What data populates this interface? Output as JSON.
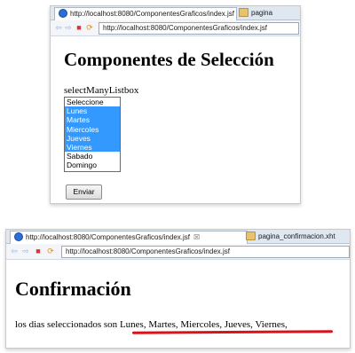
{
  "window1": {
    "tabs": [
      {
        "label": "http://localhost:8080/ComponentesGraficos/index.jsf",
        "close": "☒"
      },
      {
        "label": "pagina"
      }
    ],
    "url": "http://localhost:8080/ComponentesGraficos/index.jsf",
    "heading": "Componentes de Selección",
    "list_label": "selectManyListbox",
    "list_options": [
      {
        "label": "Seleccione",
        "selected": false
      },
      {
        "label": "Lunes",
        "selected": true
      },
      {
        "label": "Martes",
        "selected": true
      },
      {
        "label": "Miercoles",
        "selected": true
      },
      {
        "label": "Jueves",
        "selected": true
      },
      {
        "label": "Viernes",
        "selected": true
      },
      {
        "label": "Sabado",
        "selected": false
      },
      {
        "label": "Domingo",
        "selected": false
      }
    ],
    "submit_label": "Enviar"
  },
  "window2": {
    "tabs": [
      {
        "label": "http://localhost:8080/ComponentesGraficos/index.jsf",
        "close": "☒"
      },
      {
        "label": "pagina_confirmacion.xht"
      }
    ],
    "url": "http://localhost:8080/ComponentesGraficos/index.jsf",
    "heading": "Confirmación",
    "text_prefix": "los dias seleccionados son",
    "selected_days": "Lunes, Martes, Miercoles, Jueves, Viernes,"
  },
  "colors": {
    "selection": "#3399ff",
    "annotation": "#d9121a"
  }
}
